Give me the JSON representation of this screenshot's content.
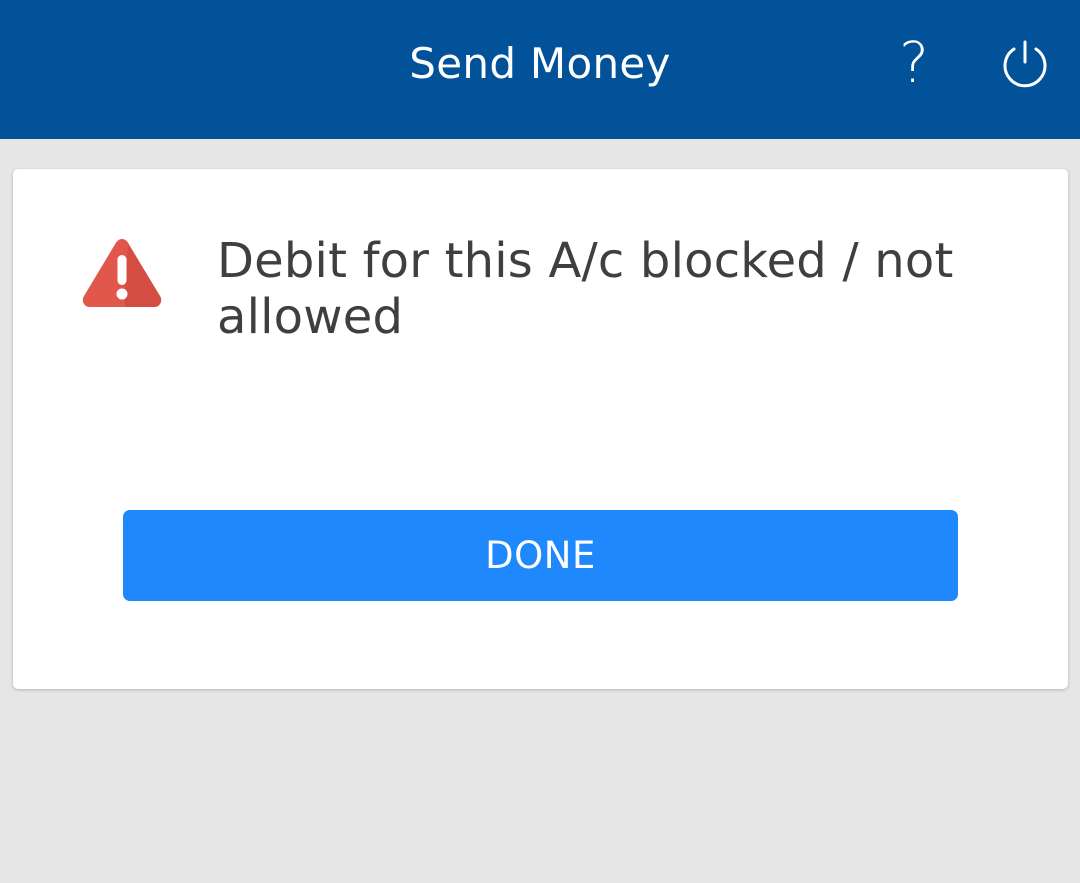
{
  "header": {
    "title": "Send Money",
    "help_label": "?",
    "help_icon": "question-mark-icon",
    "power_icon": "power-icon"
  },
  "dialog": {
    "icon": "warning-icon",
    "message": "Debit for this A/c blocked / not allowed",
    "done_label": "DONE"
  },
  "colors": {
    "header_bg": "#02529a",
    "page_bg": "#e6e6e6",
    "card_bg": "#ffffff",
    "button_bg": "#1f88fc",
    "warning": "#e2574c",
    "message_text": "#3f3f3f"
  }
}
